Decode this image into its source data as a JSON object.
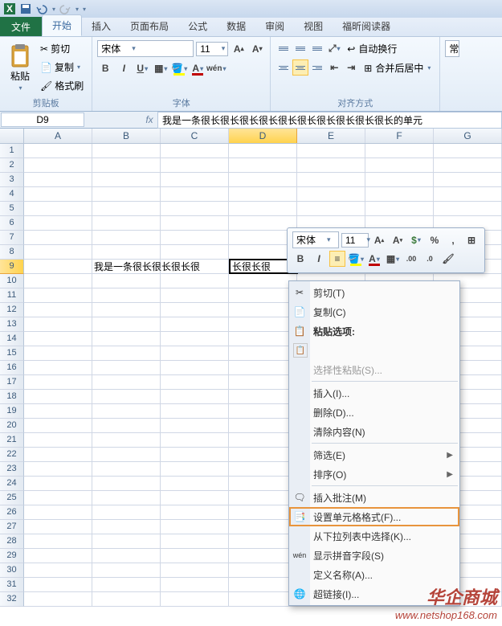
{
  "titlebar": {
    "app": "Excel"
  },
  "tabs": {
    "file": "文件",
    "home": "开始",
    "insert": "插入",
    "layout": "页面布局",
    "formulas": "公式",
    "data": "数据",
    "review": "审阅",
    "view": "视图",
    "foxit": "福昕阅读器"
  },
  "ribbon": {
    "clipboard": {
      "label": "剪贴板",
      "paste": "粘贴",
      "cut": "剪切",
      "copy": "复制",
      "painter": "格式刷"
    },
    "font": {
      "label": "字体",
      "name": "宋体",
      "size": "11"
    },
    "align": {
      "label": "对齐方式",
      "wrap": "自动换行",
      "merge": "合并后居中"
    },
    "general": "常"
  },
  "namebox": "D9",
  "formula": "我是一条很长很长很长很长很长很长很长很长很长很长的单元",
  "columns": [
    "A",
    "B",
    "C",
    "D",
    "E",
    "F",
    "G"
  ],
  "row_count": 32,
  "cell_text": "我是一条很长很长很长很",
  "sel_text": "长很长很",
  "mini": {
    "font": "宋体",
    "size": "11"
  },
  "menu": {
    "cut": "剪切(T)",
    "copy": "复制(C)",
    "paste_opts": "粘贴选项:",
    "paste_special": "选择性粘贴(S)...",
    "insert": "插入(I)...",
    "delete": "删除(D)...",
    "clear": "清除内容(N)",
    "filter": "筛选(E)",
    "sort": "排序(O)",
    "comment": "插入批注(M)",
    "format": "设置单元格格式(F)...",
    "dropdown": "从下拉列表中选择(K)...",
    "pinyin": "显示拼音字段(S)",
    "define": "定义名称(A)...",
    "hyperlink": "超链接(I)..."
  },
  "watermark": {
    "name": "华企商城",
    "url": "www.netshop168.com"
  }
}
